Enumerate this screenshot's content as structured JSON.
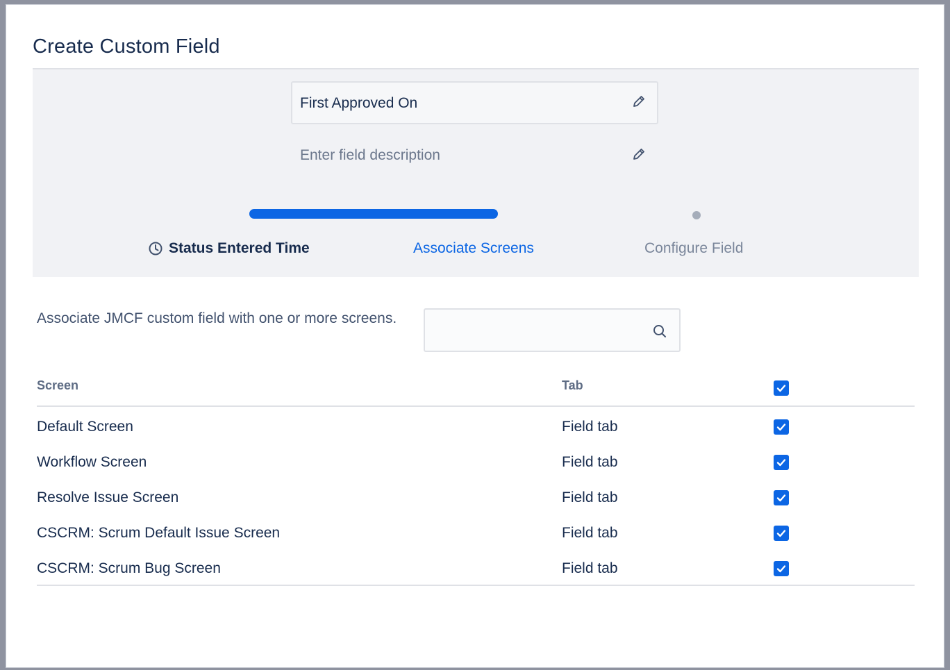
{
  "dialog": {
    "title": "Create Custom Field"
  },
  "field": {
    "name": "First Approved On",
    "description_placeholder": "Enter field description"
  },
  "wizard": {
    "progress": 0.5,
    "steps": [
      {
        "label": "Status Entered Time",
        "state": "completed"
      },
      {
        "label": "Associate Screens",
        "state": "active"
      },
      {
        "label": "Configure Field",
        "state": "pending"
      }
    ]
  },
  "associate": {
    "description": "Associate JMCF custom field with one or more screens.",
    "search_value": ""
  },
  "table": {
    "columns": {
      "screen": "Screen",
      "tab": "Tab"
    },
    "select_all_checked": true,
    "rows": [
      {
        "screen": "Default Screen",
        "tab": "Field tab",
        "checked": true
      },
      {
        "screen": "Workflow Screen",
        "tab": "Field tab",
        "checked": true
      },
      {
        "screen": "Resolve Issue Screen",
        "tab": "Field tab",
        "checked": true
      },
      {
        "screen": "CSCRM: Scrum Default Issue Screen",
        "tab": "Field tab",
        "checked": true
      },
      {
        "screen": "CSCRM: Scrum Bug Screen",
        "tab": "Field tab",
        "checked": true
      }
    ]
  },
  "colors": {
    "primary": "#0c66e4",
    "text": "#172b4d",
    "muted": "#7a869a",
    "panel": "#f1f2f5"
  }
}
